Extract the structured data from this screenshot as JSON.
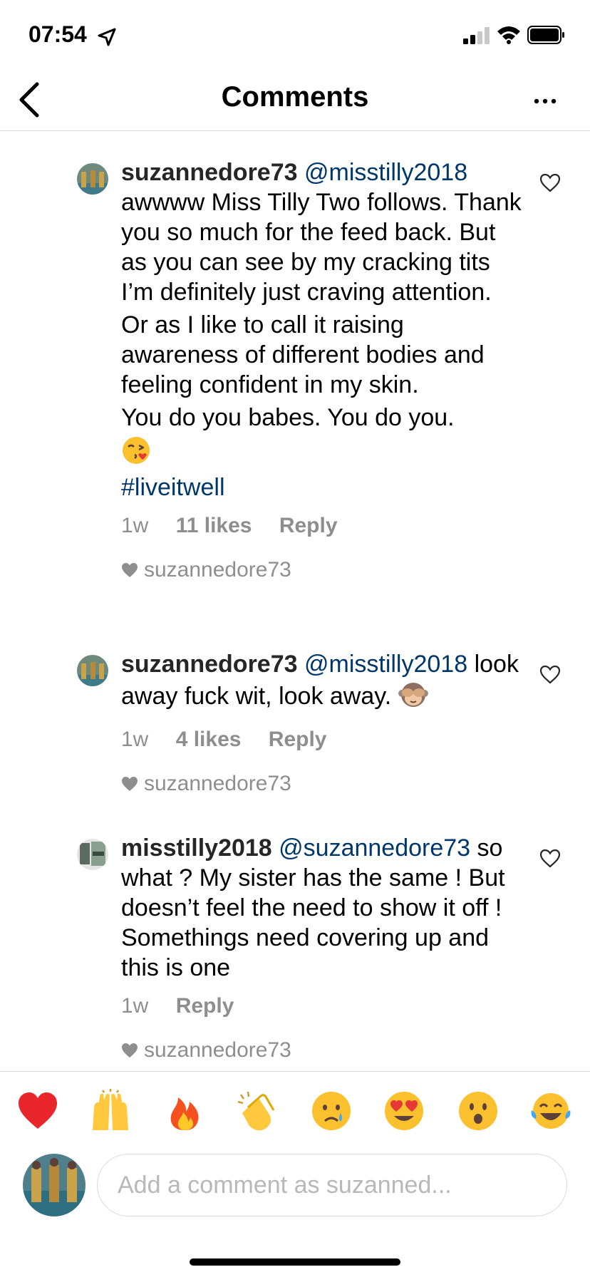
{
  "status_bar": {
    "time": "07:54"
  },
  "header": {
    "title": "Comments"
  },
  "comments": [
    {
      "username": "suzannedore73",
      "mention": "@misstilly2018",
      "paragraphs": [
        "awwww Miss Tilly Two follows. Thank you so much for the feed back. But as you can see by my cracking tits I’m definitely just craving attention.",
        "Or as I like to call it raising awareness of different bodies and feeling confident in my skin.",
        "You do you babes. You do you."
      ],
      "emoji": "kissing-heart",
      "hashtag": "#liveitwell",
      "time": "1w",
      "likes": "11 likes",
      "reply": "Reply",
      "liked_by": "suzannedore73"
    },
    {
      "username": "suzannedore73",
      "mention": "@misstilly2018",
      "text": "look away fuck wit, look away.",
      "emoji": "see-no-evil-monkey",
      "time": "1w",
      "likes": "4 likes",
      "reply": "Reply",
      "liked_by": "suzannedore73"
    },
    {
      "username": "misstilly2018",
      "mention": "@suzannedore73",
      "text": "so what ? My sister has the same ! But doesn’t feel the need to show it off ! Somethings need covering up and this is one",
      "time": "1w",
      "reply": "Reply",
      "liked_by": "suzannedore73"
    }
  ],
  "emoji_bar": [
    "red-heart",
    "raising-hands",
    "fire",
    "clapping-hands",
    "crying-face",
    "heart-eyes",
    "surprised-face",
    "tears-of-joy"
  ],
  "composer": {
    "placeholder": "Add a comment as suzanned..."
  },
  "colors": {
    "mention": "#00376b",
    "muted": "#8e8e8e",
    "divider": "#dbdbdb"
  }
}
